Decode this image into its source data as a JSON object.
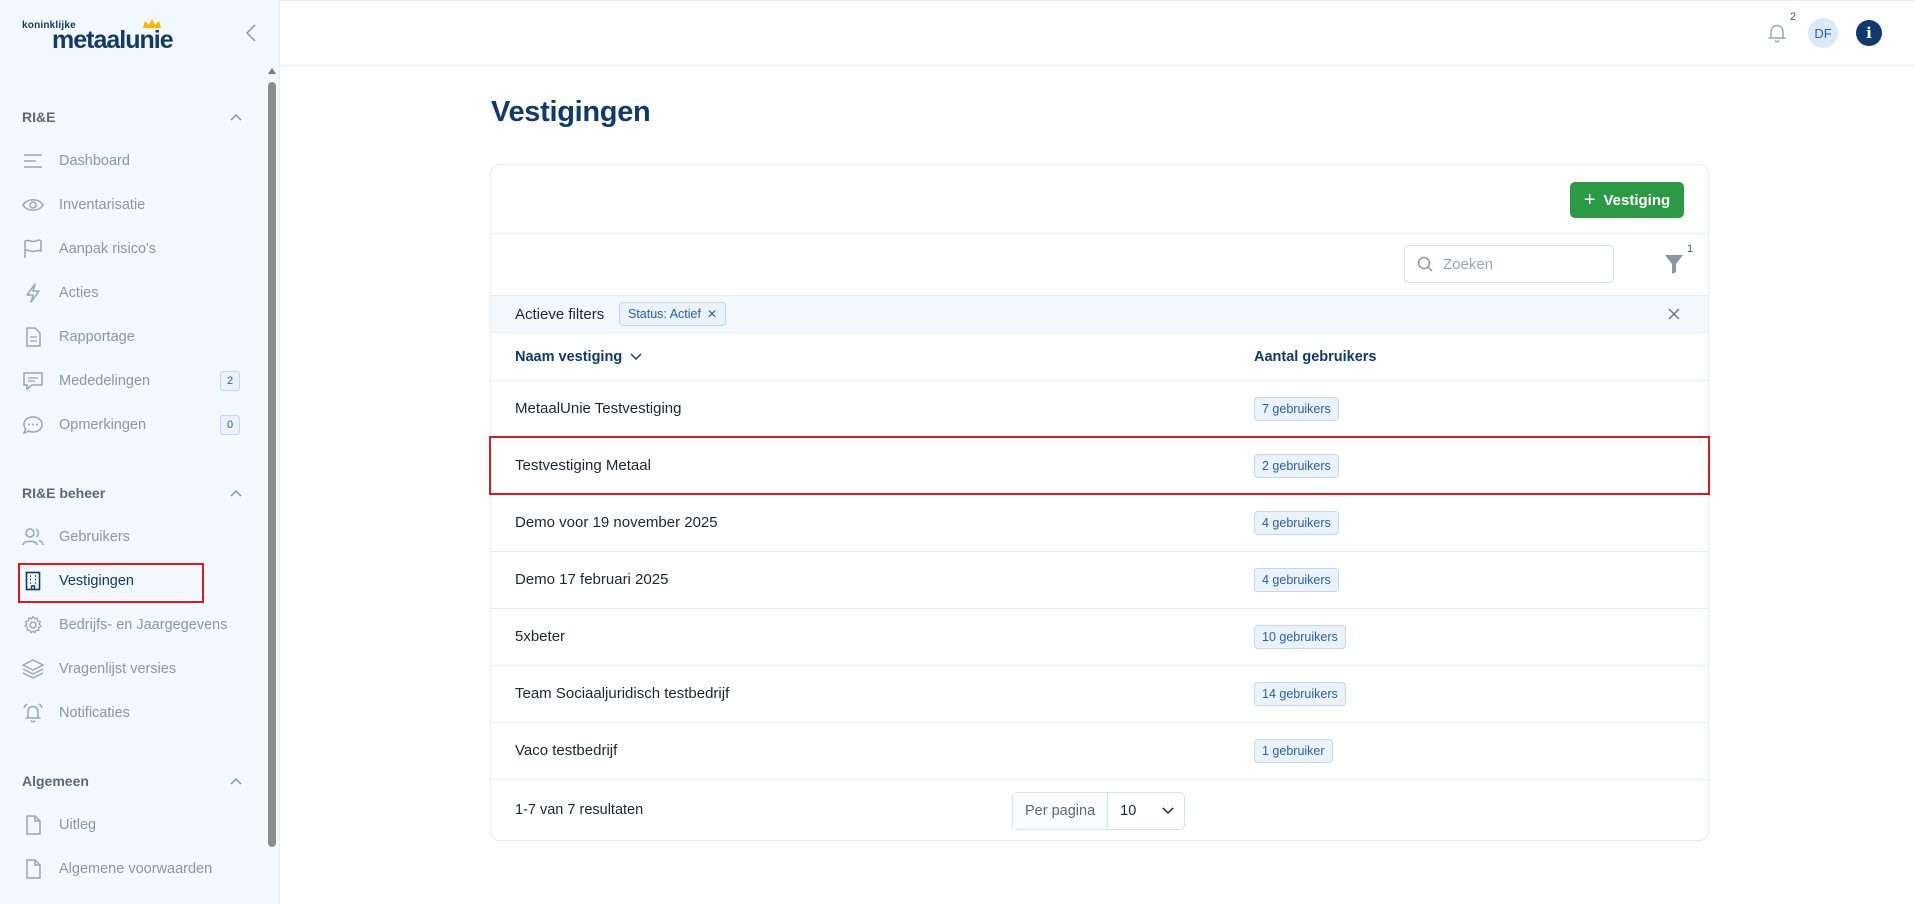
{
  "brand": {
    "logo_small": "koninklijke",
    "logo_big": "metaalunie"
  },
  "sidebar": {
    "sections": [
      {
        "title": "RI&E",
        "items": [
          {
            "label": "Dashboard",
            "icon": "menu-lines-icon"
          },
          {
            "label": "Inventarisatie",
            "icon": "eye-icon"
          },
          {
            "label": "Aanpak risico's",
            "icon": "flag-icon"
          },
          {
            "label": "Acties",
            "icon": "lightning-icon"
          },
          {
            "label": "Rapportage",
            "icon": "document-icon"
          },
          {
            "label": "Mededelingen",
            "icon": "message-icon",
            "badge": "2"
          },
          {
            "label": "Opmerkingen",
            "icon": "chat-dots-icon",
            "badge": "0"
          }
        ]
      },
      {
        "title": "RI&E beheer",
        "items": [
          {
            "label": "Gebruikers",
            "icon": "users-icon"
          },
          {
            "label": "Vestigingen",
            "icon": "building-icon",
            "active": true
          },
          {
            "label": "Bedrijfs- en Jaargegevens",
            "icon": "gear-icon"
          },
          {
            "label": "Vragenlijst versies",
            "icon": "layers-icon"
          },
          {
            "label": "Notificaties",
            "icon": "bell-ring-icon"
          }
        ]
      },
      {
        "title": "Algemeen",
        "items": [
          {
            "label": "Uitleg",
            "icon": "file-icon"
          },
          {
            "label": "Algemene voorwaarden",
            "icon": "file-icon"
          }
        ]
      }
    ]
  },
  "topbar": {
    "notification_count": "2",
    "avatar_initials": "DF",
    "info_label": "i"
  },
  "main": {
    "title": "Vestigingen",
    "add_button": "Vestiging",
    "search": {
      "placeholder": "Zoeken",
      "value": ""
    },
    "filter_count": "1",
    "active_filters": {
      "label": "Actieve filters",
      "chips": [
        "Status: Actief"
      ]
    },
    "columns": [
      "Naam vestiging",
      "Aantal gebruikers"
    ],
    "rows": [
      {
        "name": "MetaalUnie Testvestiging",
        "users": "7 gebruikers"
      },
      {
        "name": "Testvestiging Metaal",
        "users": "2 gebruikers",
        "highlighted": true
      },
      {
        "name": "Demo voor 19 november 2025",
        "users": "4 gebruikers"
      },
      {
        "name": "Demo 17 februari 2025",
        "users": "4 gebruikers"
      },
      {
        "name": "5xbeter",
        "users": "10 gebruikers"
      },
      {
        "name": "Team Sociaaljuridisch testbedrijf",
        "users": "14 gebruikers"
      },
      {
        "name": "Vaco testbedrijf",
        "users": "1 gebruiker"
      }
    ],
    "pagination": {
      "summary": "1-7 van 7 resultaten",
      "per_page_label": "Per pagina",
      "per_page_value": "10"
    }
  },
  "colors": {
    "primary": "#0f3a6b",
    "accent_green": "#2c9a45",
    "highlight": "#e0191e",
    "badge_bg": "#eaf2fb",
    "badge_text": "#2a5fb0"
  }
}
